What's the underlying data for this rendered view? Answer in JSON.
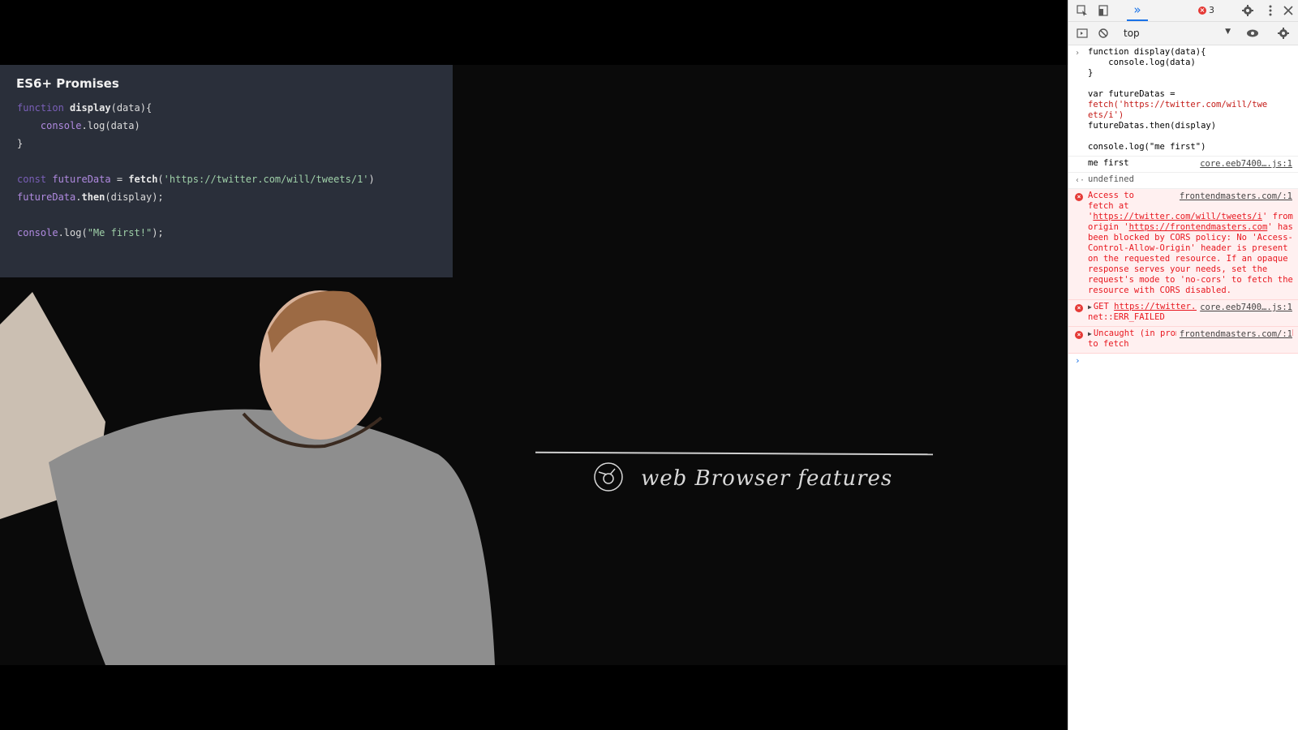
{
  "slide": {
    "title": "ES6+ Promises",
    "code": [
      "function display(data){",
      "    console.log(data)",
      "}",
      "",
      "const futureData = fetch('https://twitter.com/will/tweets/1')",
      "futureData.then(display);",
      "",
      "console.log(\"Me first!\");"
    ]
  },
  "whiteboard": {
    "caption": "web Browser features"
  },
  "devtools": {
    "error_count": "3",
    "context": "top",
    "input_code": [
      "function display(data){",
      "    console.log(data)",
      "}",
      "",
      "var futureDatas =",
      "fetch('https://twitter.com/will/twe",
      "ets/i')",
      "futureDatas.then(display)",
      "",
      "console.log(\"me first\")"
    ],
    "log_message": "me first",
    "log_source": "core.eeb7400….js:1",
    "return_value": "undefined",
    "errors": [
      {
        "source": "frontendmasters.com/:1",
        "text_a": "Access to\nfetch at '",
        "url1": "https://twitter.com/will/tweets/i",
        "text_b": "' from origin '",
        "url2": "https://frontendmasters.com",
        "text_c": "' has been blocked by CORS policy: No 'Access-Control-Allow-Origin' header is present on the requested resource. If an opaque response serves your needs, set the request's mode to 'no-cors' to fetch the resource with CORS disabled."
      },
      {
        "source": "core.eeb7400….js:1",
        "prefix": "GET ",
        "url": "https://twitter.com/will/tweets/i",
        "suffix": "net::ERR_FAILED"
      },
      {
        "source": "frontendmasters.com/:1",
        "text": "Uncaught (in promise) TypeError: Failed to fetch"
      }
    ]
  },
  "colors": {
    "error_red": "#e8171f",
    "accent_blue": "#1a73e8",
    "slide_bg": "#2a2f3a"
  }
}
